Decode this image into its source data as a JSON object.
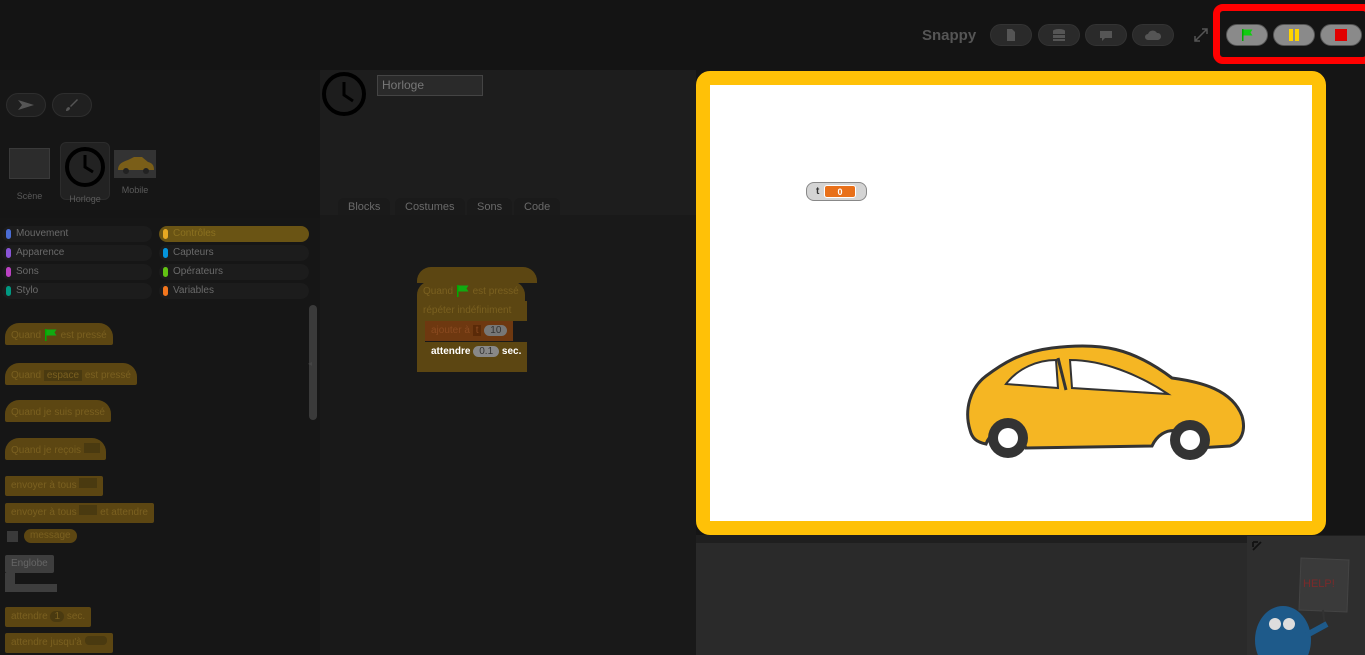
{
  "topbar": {
    "title": "Snappy",
    "buttons": [
      "file-icon",
      "database-icon",
      "speech-bubble-icon",
      "cloud-icon",
      "fullscreen-icon"
    ],
    "run_controls": [
      "green-flag-icon",
      "pause-icon",
      "stop-icon"
    ],
    "highlight_color": "#ff0000"
  },
  "corral": {
    "items": [
      {
        "label": "Scène"
      },
      {
        "label": "Horloge"
      },
      {
        "label": "Mobile"
      }
    ]
  },
  "categories": [
    {
      "label": "Mouvement",
      "color": "#4a6cd4"
    },
    {
      "label": "Contrôles",
      "color": "#e6a822"
    },
    {
      "label": "Apparence",
      "color": "#8a55d7"
    },
    {
      "label": "Capteurs",
      "color": "#0494dc"
    },
    {
      "label": "Sons",
      "color": "#bb42c3"
    },
    {
      "label": "Opérateurs",
      "color": "#62c213"
    },
    {
      "label": "Stylo",
      "color": "#009982"
    },
    {
      "label": "Variables",
      "color": "#f3761d"
    }
  ],
  "palette": {
    "when_flag": [
      "Quand",
      "est pressé"
    ],
    "when_key": [
      "Quand",
      "espace",
      "est pressé"
    ],
    "when_clicked": "Quand je suis pressé",
    "when_receive": "Quand je reçois",
    "broadcast": "envoyer à tous",
    "broadcast_wait": [
      "envoyer à tous",
      "et attendre"
    ],
    "message": "message",
    "warp": "Englobe",
    "wait": [
      "attendre",
      "1",
      "sec."
    ],
    "wait_until": "attendre jusqu'à"
  },
  "sprite": {
    "name": "Horloge",
    "tabs": [
      "Blocks",
      "Costumes",
      "Sons",
      "Code"
    ]
  },
  "script": {
    "hat": [
      "Quand",
      "est pressé"
    ],
    "forever": "répéter indéfiniment",
    "change": [
      "ajouter à",
      "t",
      "10"
    ],
    "wait": [
      "attendre",
      "0.1",
      "sec."
    ]
  },
  "stage": {
    "border_color": "#ffc107",
    "watcher": {
      "label": "t",
      "value": "0"
    },
    "car_color": "#f5b623"
  },
  "help": {
    "sign": "HELP!"
  }
}
